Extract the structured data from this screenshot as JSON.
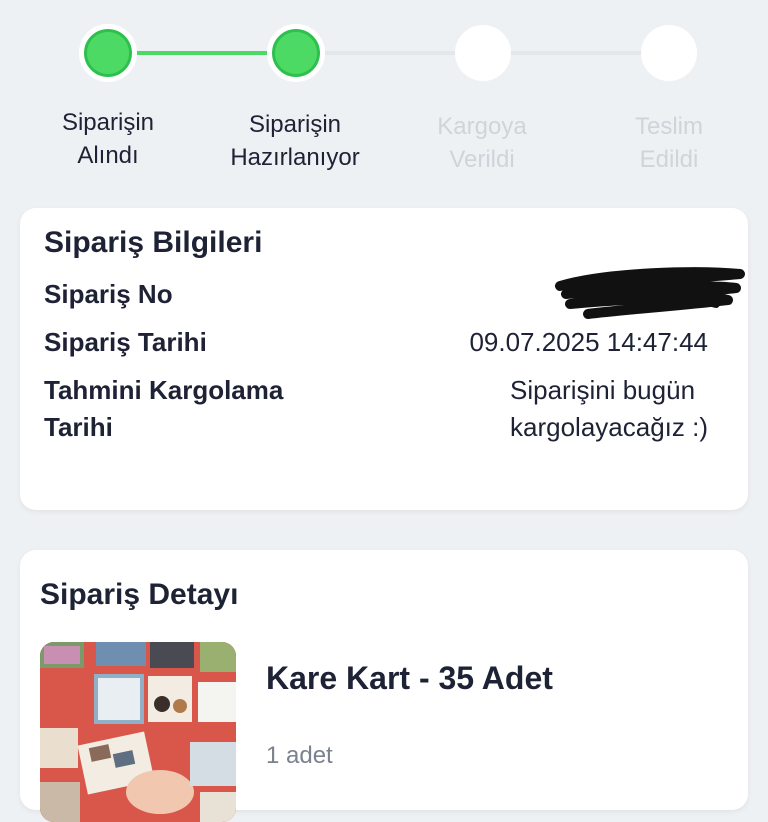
{
  "tracker": {
    "steps": [
      {
        "label_line1": "Siparişin",
        "label_line2": "Alındı",
        "state": "done"
      },
      {
        "label_line1": "Siparişin",
        "label_line2": "Hazırlanıyor",
        "state": "done"
      },
      {
        "label_line1": "Kargoya",
        "label_line2": "Verildi",
        "state": "pending"
      },
      {
        "label_line1": "Teslim",
        "label_line2": "Edildi",
        "state": "pending"
      }
    ],
    "done_color": "#4cd964",
    "pending_color": "#d0d4da"
  },
  "order_info": {
    "title": "Sipariş Bilgileri",
    "order_no_label": "Sipariş No",
    "order_date_label": "Sipariş Tarihi",
    "order_date_value": "09.07.2025 14:47:44",
    "estimated_label_line1": "Tahmini Kargolama",
    "estimated_label_line2": "Tarihi",
    "estimated_value_line1": "Siparişini bugün",
    "estimated_value_line2": "kargolayacağız :)"
  },
  "order_detail": {
    "title": "Sipariş Detayı",
    "product_name": "Kare Kart - 35 Adet",
    "product_quantity": "1 adet"
  }
}
